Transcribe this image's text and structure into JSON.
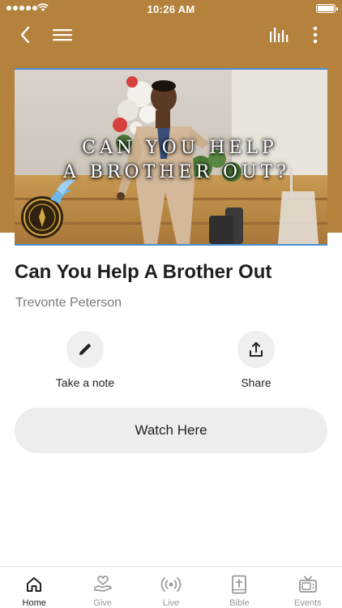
{
  "status_bar": {
    "time": "10:26 AM"
  },
  "header": {
    "background": "#b5823e"
  },
  "media": {
    "caption_line1": "CAN YOU HELP",
    "caption_line2": "A BROTHER OUT?"
  },
  "sermon": {
    "title": "Can You Help A Brother Out",
    "speaker": "Trevonte Peterson"
  },
  "actions": {
    "note_label": "Take a note",
    "share_label": "Share"
  },
  "watch_button": {
    "label": "Watch Here"
  },
  "tabs": [
    {
      "label": "Home",
      "icon": "home-icon",
      "active": true
    },
    {
      "label": "Give",
      "icon": "give-icon",
      "active": false
    },
    {
      "label": "Live",
      "icon": "live-icon",
      "active": false
    },
    {
      "label": "Bible",
      "icon": "bible-icon",
      "active": false
    },
    {
      "label": "Events",
      "icon": "tv-icon",
      "active": false
    }
  ]
}
